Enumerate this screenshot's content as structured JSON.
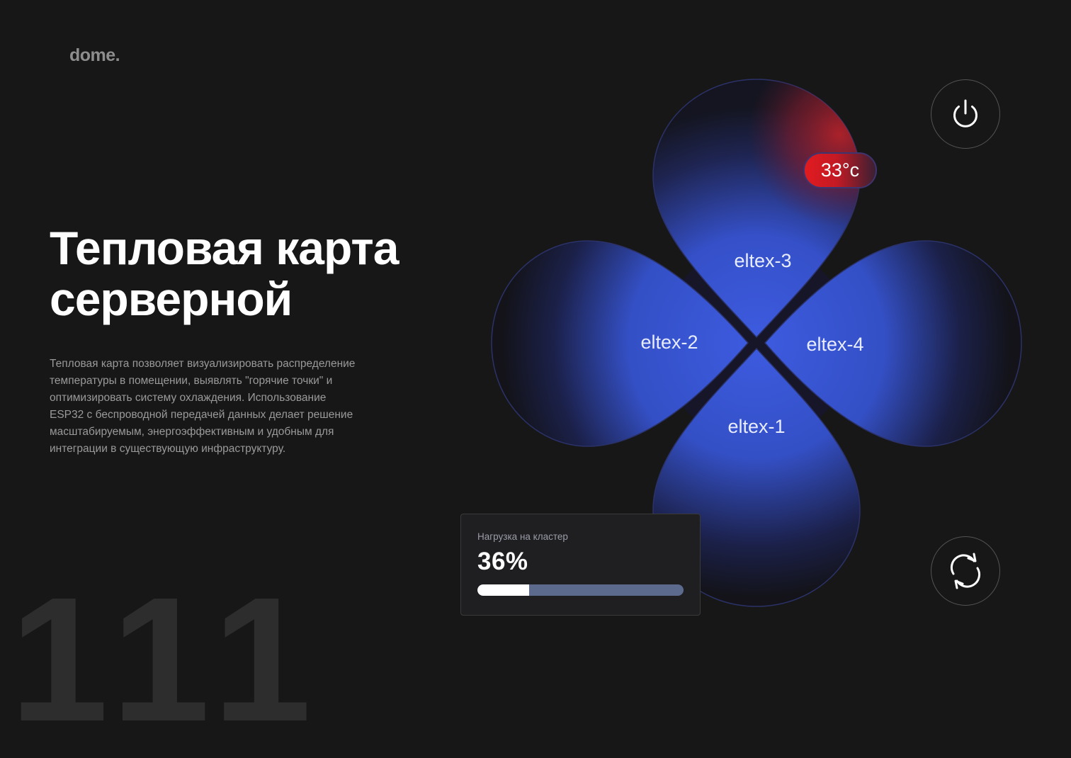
{
  "brand": {
    "logo": "dome."
  },
  "hero": {
    "title_lines": [
      "Тепловая карта",
      "серверной"
    ],
    "description": "Тепловая карта позволяет визуализировать распределение температуры в помещении, выявлять \"горячие точки\" и оптимизировать систему охлаждения. Использование ESP32 с беспроводной передачей данных делает решение масштабируемым, энергоэффективным и удобным для интеграции в существующую инфраструктуру.",
    "background_number": "111"
  },
  "heatmap": {
    "petals": [
      {
        "id": "top",
        "label": "eltex-3",
        "hot": true
      },
      {
        "id": "left",
        "label": "eltex-2",
        "hot": false
      },
      {
        "id": "right",
        "label": "eltex-4",
        "hot": false
      },
      {
        "id": "bottom",
        "label": "eltex-1",
        "hot": false
      }
    ],
    "temperature_badge": "33°c",
    "colors": {
      "petal": "#3f5fe0",
      "hot": "#e21b20",
      "background": "#171717"
    }
  },
  "controls": {
    "power_icon": "power-icon",
    "refresh_icon": "refresh-icon"
  },
  "cluster": {
    "label": "Нагрузка на кластер",
    "value_text": "36%",
    "load_fraction": 0.25
  }
}
